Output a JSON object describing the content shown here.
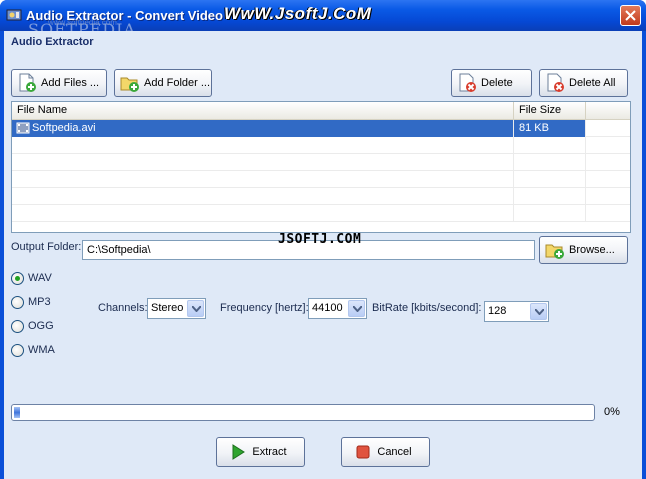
{
  "window": {
    "title": "Audio Extractor - Convert Video",
    "title_overlay": "WwW.JsoftJ.CoM",
    "brand_watermark": "SOFTPEDIA",
    "brand_watermark_url": "www.softpedia.com"
  },
  "panel": {
    "title": "Audio Extractor"
  },
  "toolbar": {
    "add_files": "Add Files ...",
    "add_folder": "Add Folder ...",
    "delete": "Delete",
    "delete_all": "Delete All"
  },
  "file_list": {
    "columns": [
      "File Name",
      "File Size"
    ],
    "rows": [
      {
        "name": "Softpedia.avi",
        "size": "81 KB",
        "selected": true
      }
    ]
  },
  "output": {
    "label": "Output Folder:",
    "value": "C:\\Softpedia\\",
    "browse": "Browse...",
    "watermark": "JSOFTJ.COM"
  },
  "formats": {
    "options": [
      "WAV",
      "MP3",
      "OGG",
      "WMA"
    ],
    "selected": "WAV"
  },
  "settings": {
    "channels_label": "Channels:",
    "channels_value": "Stereo",
    "frequency_label": "Frequency [hertz]:",
    "frequency_value": "44100",
    "bitrate_label": "BitRate [kbits/second]:",
    "bitrate_value": "128"
  },
  "progress": {
    "value": 0.01,
    "text": "0%"
  },
  "actions": {
    "extract": "Extract",
    "cancel": "Cancel"
  },
  "colors": {
    "title_bar": "#0a5ae6",
    "client_bg": "#dfe9f7",
    "selection": "#316ac5",
    "accent_green": "#21a121"
  }
}
